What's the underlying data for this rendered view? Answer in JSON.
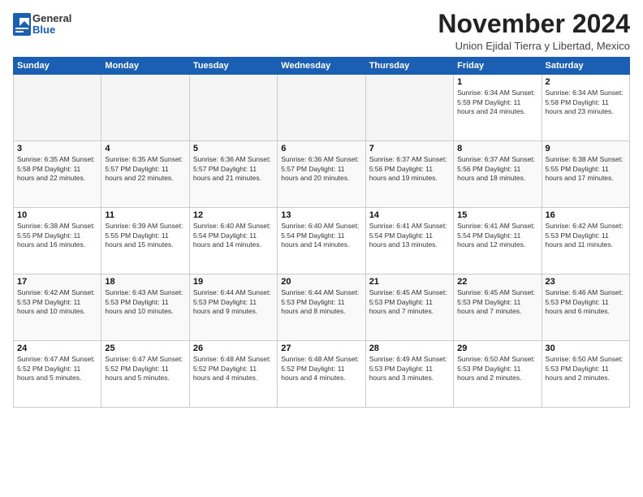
{
  "header": {
    "logo_general": "General",
    "logo_blue": "Blue",
    "month_title": "November 2024",
    "subtitle": "Union Ejidal Tierra y Libertad, Mexico"
  },
  "weekdays": [
    "Sunday",
    "Monday",
    "Tuesday",
    "Wednesday",
    "Thursday",
    "Friday",
    "Saturday"
  ],
  "weeks": [
    [
      {
        "day": "",
        "info": ""
      },
      {
        "day": "",
        "info": ""
      },
      {
        "day": "",
        "info": ""
      },
      {
        "day": "",
        "info": ""
      },
      {
        "day": "",
        "info": ""
      },
      {
        "day": "1",
        "info": "Sunrise: 6:34 AM\nSunset: 5:59 PM\nDaylight: 11 hours\nand 24 minutes."
      },
      {
        "day": "2",
        "info": "Sunrise: 6:34 AM\nSunset: 5:58 PM\nDaylight: 11 hours\nand 23 minutes."
      }
    ],
    [
      {
        "day": "3",
        "info": "Sunrise: 6:35 AM\nSunset: 5:58 PM\nDaylight: 11 hours\nand 22 minutes."
      },
      {
        "day": "4",
        "info": "Sunrise: 6:35 AM\nSunset: 5:57 PM\nDaylight: 11 hours\nand 22 minutes."
      },
      {
        "day": "5",
        "info": "Sunrise: 6:36 AM\nSunset: 5:57 PM\nDaylight: 11 hours\nand 21 minutes."
      },
      {
        "day": "6",
        "info": "Sunrise: 6:36 AM\nSunset: 5:57 PM\nDaylight: 11 hours\nand 20 minutes."
      },
      {
        "day": "7",
        "info": "Sunrise: 6:37 AM\nSunset: 5:56 PM\nDaylight: 11 hours\nand 19 minutes."
      },
      {
        "day": "8",
        "info": "Sunrise: 6:37 AM\nSunset: 5:56 PM\nDaylight: 11 hours\nand 18 minutes."
      },
      {
        "day": "9",
        "info": "Sunrise: 6:38 AM\nSunset: 5:55 PM\nDaylight: 11 hours\nand 17 minutes."
      }
    ],
    [
      {
        "day": "10",
        "info": "Sunrise: 6:38 AM\nSunset: 5:55 PM\nDaylight: 11 hours\nand 16 minutes."
      },
      {
        "day": "11",
        "info": "Sunrise: 6:39 AM\nSunset: 5:55 PM\nDaylight: 11 hours\nand 15 minutes."
      },
      {
        "day": "12",
        "info": "Sunrise: 6:40 AM\nSunset: 5:54 PM\nDaylight: 11 hours\nand 14 minutes."
      },
      {
        "day": "13",
        "info": "Sunrise: 6:40 AM\nSunset: 5:54 PM\nDaylight: 11 hours\nand 14 minutes."
      },
      {
        "day": "14",
        "info": "Sunrise: 6:41 AM\nSunset: 5:54 PM\nDaylight: 11 hours\nand 13 minutes."
      },
      {
        "day": "15",
        "info": "Sunrise: 6:41 AM\nSunset: 5:54 PM\nDaylight: 11 hours\nand 12 minutes."
      },
      {
        "day": "16",
        "info": "Sunrise: 6:42 AM\nSunset: 5:53 PM\nDaylight: 11 hours\nand 11 minutes."
      }
    ],
    [
      {
        "day": "17",
        "info": "Sunrise: 6:42 AM\nSunset: 5:53 PM\nDaylight: 11 hours\nand 10 minutes."
      },
      {
        "day": "18",
        "info": "Sunrise: 6:43 AM\nSunset: 5:53 PM\nDaylight: 11 hours\nand 10 minutes."
      },
      {
        "day": "19",
        "info": "Sunrise: 6:44 AM\nSunset: 5:53 PM\nDaylight: 11 hours\nand 9 minutes."
      },
      {
        "day": "20",
        "info": "Sunrise: 6:44 AM\nSunset: 5:53 PM\nDaylight: 11 hours\nand 8 minutes."
      },
      {
        "day": "21",
        "info": "Sunrise: 6:45 AM\nSunset: 5:53 PM\nDaylight: 11 hours\nand 7 minutes."
      },
      {
        "day": "22",
        "info": "Sunrise: 6:45 AM\nSunset: 5:53 PM\nDaylight: 11 hours\nand 7 minutes."
      },
      {
        "day": "23",
        "info": "Sunrise: 6:46 AM\nSunset: 5:53 PM\nDaylight: 11 hours\nand 6 minutes."
      }
    ],
    [
      {
        "day": "24",
        "info": "Sunrise: 6:47 AM\nSunset: 5:52 PM\nDaylight: 11 hours\nand 5 minutes."
      },
      {
        "day": "25",
        "info": "Sunrise: 6:47 AM\nSunset: 5:52 PM\nDaylight: 11 hours\nand 5 minutes."
      },
      {
        "day": "26",
        "info": "Sunrise: 6:48 AM\nSunset: 5:52 PM\nDaylight: 11 hours\nand 4 minutes."
      },
      {
        "day": "27",
        "info": "Sunrise: 6:48 AM\nSunset: 5:52 PM\nDaylight: 11 hours\nand 4 minutes."
      },
      {
        "day": "28",
        "info": "Sunrise: 6:49 AM\nSunset: 5:53 PM\nDaylight: 11 hours\nand 3 minutes."
      },
      {
        "day": "29",
        "info": "Sunrise: 6:50 AM\nSunset: 5:53 PM\nDaylight: 11 hours\nand 2 minutes."
      },
      {
        "day": "30",
        "info": "Sunrise: 6:50 AM\nSunset: 5:53 PM\nDaylight: 11 hours\nand 2 minutes."
      }
    ]
  ]
}
